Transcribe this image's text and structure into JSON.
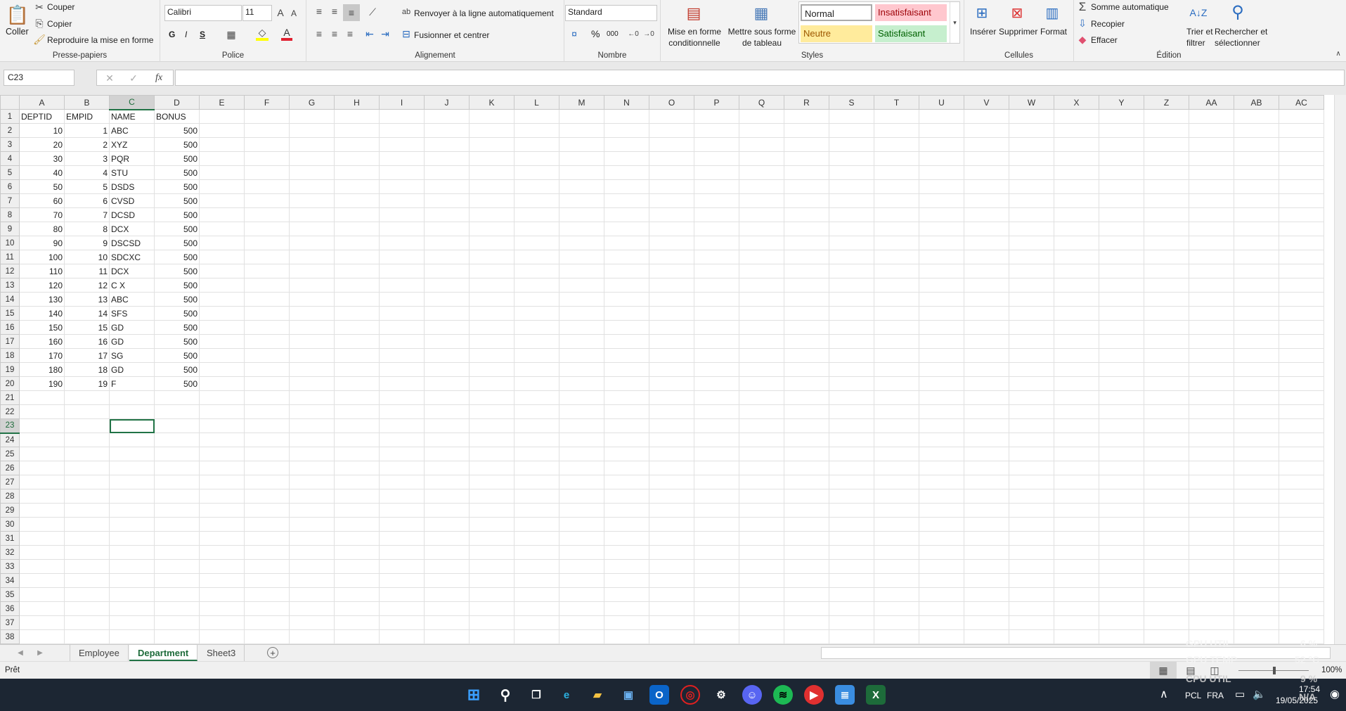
{
  "ribbon": {
    "clipboard": {
      "paste": "Coller",
      "cut": "Couper",
      "copy": "Copier",
      "format_painter": "Reproduire la mise en forme",
      "label": "Presse-papiers"
    },
    "font": {
      "name": "Calibri",
      "size": "11",
      "bold": "G",
      "italic": "I",
      "underline": "S",
      "label": "Police"
    },
    "alignment": {
      "wrap": "Renvoyer à la ligne automatiquement",
      "merge": "Fusionner et centrer",
      "label": "Alignement"
    },
    "number": {
      "format": "Standard",
      "percent": "%",
      "thousands": "000",
      "label": "Nombre"
    },
    "styles": {
      "conditional": [
        "Mise en forme",
        "conditionnelle"
      ],
      "table": [
        "Mettre sous forme",
        "de tableau"
      ],
      "normal": "Normal",
      "bad": "Insatisfaisant",
      "neutral": "Neutre",
      "good": "Satisfaisant",
      "label": "Styles"
    },
    "cells": {
      "insert": "Insérer",
      "delete": "Supprimer",
      "format": "Format",
      "label": "Cellules"
    },
    "editing": {
      "autosum": "Somme automatique",
      "fill": "Recopier",
      "clear": "Effacer",
      "sort": [
        "Trier et",
        "filtrer"
      ],
      "find": [
        "Rechercher et",
        "sélectionner"
      ],
      "label": "Édition"
    }
  },
  "formula_bar": {
    "name_box": "C23",
    "fx": "fx",
    "value": ""
  },
  "sheet": {
    "columns": [
      "A",
      "B",
      "C",
      "D",
      "E",
      "F",
      "G",
      "H",
      "I",
      "J",
      "K",
      "L",
      "M",
      "N",
      "O",
      "P",
      "Q",
      "R",
      "S",
      "T",
      "U",
      "V",
      "W",
      "X",
      "Y",
      "Z",
      "AA",
      "AB",
      "AC"
    ],
    "row_numbers": [
      1,
      2,
      3,
      4,
      5,
      6,
      7,
      8,
      9,
      10,
      11,
      12,
      13,
      14,
      15,
      16,
      17,
      18,
      19,
      20,
      21,
      22,
      23,
      24,
      25,
      26,
      27,
      28,
      29,
      30,
      31,
      32,
      33,
      34,
      35,
      36,
      37,
      38
    ],
    "headers": [
      "DEPTID",
      "EMPID",
      "NAME",
      "BONUS"
    ],
    "rows": [
      [
        10,
        1,
        "ABC",
        500
      ],
      [
        20,
        2,
        "XYZ",
        500
      ],
      [
        30,
        3,
        "PQR",
        500
      ],
      [
        40,
        4,
        "STU",
        500
      ],
      [
        50,
        5,
        "DSDS",
        500
      ],
      [
        60,
        6,
        "CVSD",
        500
      ],
      [
        70,
        7,
        "DCSD",
        500
      ],
      [
        80,
        8,
        "DCX",
        500
      ],
      [
        90,
        9,
        "DSCSD",
        500
      ],
      [
        100,
        10,
        "SDCXC",
        500
      ],
      [
        110,
        11,
        "DCX",
        500
      ],
      [
        120,
        12,
        "C X",
        500
      ],
      [
        130,
        13,
        "ABC",
        500
      ],
      [
        140,
        14,
        "SFS",
        500
      ],
      [
        150,
        15,
        "GD",
        500
      ],
      [
        160,
        16,
        "GD",
        500
      ],
      [
        170,
        17,
        "SG",
        500
      ],
      [
        180,
        18,
        "GD",
        500
      ],
      [
        190,
        19,
        "F",
        500
      ]
    ],
    "active_cell": "C23"
  },
  "tabs": [
    "Employee",
    "Department",
    "Sheet3"
  ],
  "active_tab": "Department",
  "status": {
    "ready": "Prêt",
    "zoom": "100%"
  },
  "overlay": {
    "gpu_util": "GPU UTIL",
    "gpu_util_val": "6 %",
    "gpu_temp": "GPU TEMP",
    "gpu_temp_val": "52 °C",
    "cpu_util": "CPU UTIL",
    "cpu_util_val": "9 %",
    "na": "N/A"
  },
  "tray": {
    "lang1": "PCL",
    "lang2": "FRA",
    "time": "17:54",
    "date": "19/05/2025"
  },
  "colors": {
    "excel_green": "#217346",
    "bad_bg": "#ffc7ce",
    "neutral_bg": "#ffeb9c",
    "good_bg": "#c6efce"
  }
}
